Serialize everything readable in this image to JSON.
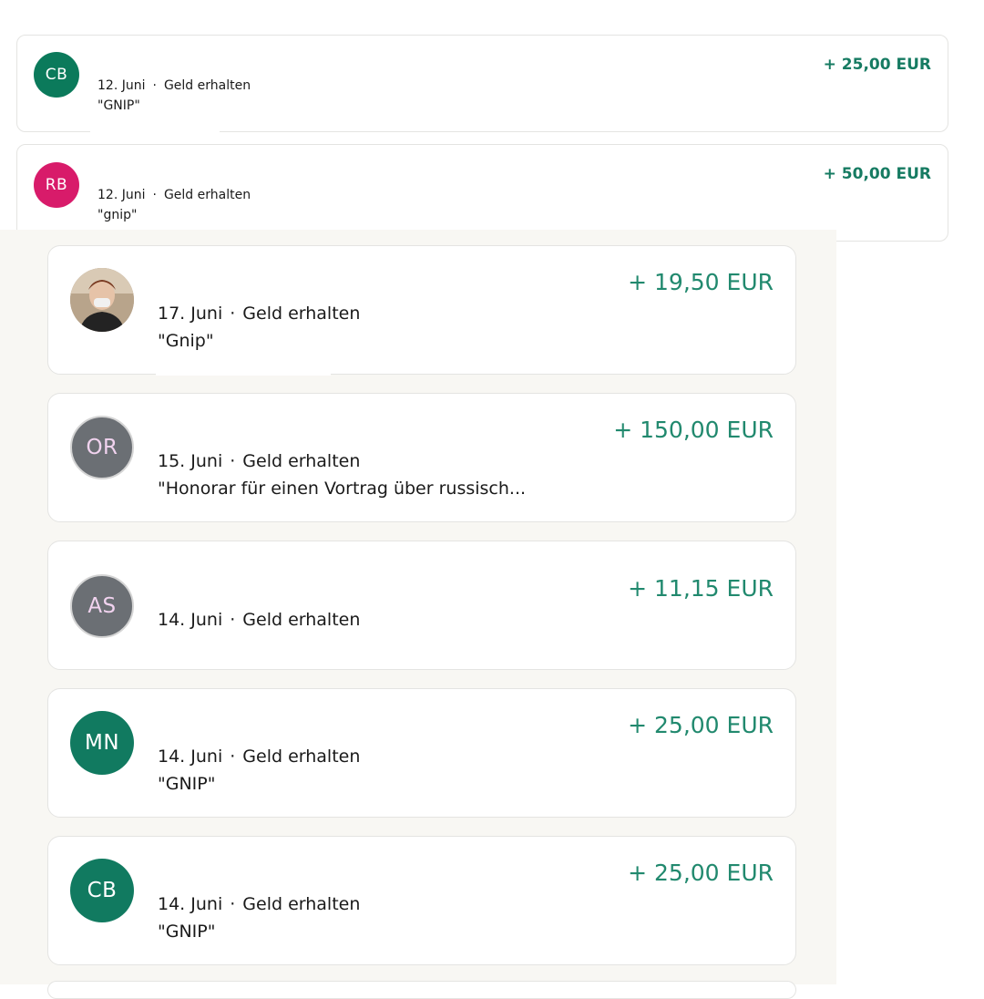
{
  "transactions": [
    {
      "avatar_initials": "CB",
      "avatar_color": "#0b7a5b",
      "date": "12. Juni",
      "type": "Geld erhalten",
      "note": "\"GNIP\"",
      "amount": "+ 25,00 EUR"
    },
    {
      "avatar_initials": "RB",
      "avatar_color": "#d81b6a",
      "date": "12. Juni",
      "type": "Geld erhalten",
      "note": "\"gnip\"",
      "amount": "+ 50,00 EUR"
    },
    {
      "avatar_type": "photo",
      "date": "17. Juni",
      "type": "Geld erhalten",
      "note": "\"Gnip\"",
      "amount": "+ 19,50 EUR"
    },
    {
      "avatar_initials": "OR",
      "avatar_color": "#6b6f74",
      "avatar_text_color": "#f1d3ef",
      "date": "15. Juni",
      "type": "Geld erhalten",
      "note": "\"Honorar für einen Vortrag über russisch...",
      "amount": "+ 150,00 EUR"
    },
    {
      "avatar_initials": "AS",
      "avatar_color": "#6b6f74",
      "avatar_text_color": "#f1d3ef",
      "date": "14. Juni",
      "type": "Geld erhalten",
      "note": "",
      "amount": "+ 11,15 EUR"
    },
    {
      "avatar_initials": "MN",
      "avatar_color": "#117a60",
      "date": "14. Juni",
      "type": "Geld erhalten",
      "note": "\"GNIP\"",
      "amount": "+ 25,00 EUR"
    },
    {
      "avatar_initials": "CB",
      "avatar_color": "#117a60",
      "date": "14. Juni",
      "type": "Geld erhalten",
      "note": "\"GNIP\"",
      "amount": "+ 25,00 EUR"
    }
  ],
  "separator_dot": "·"
}
